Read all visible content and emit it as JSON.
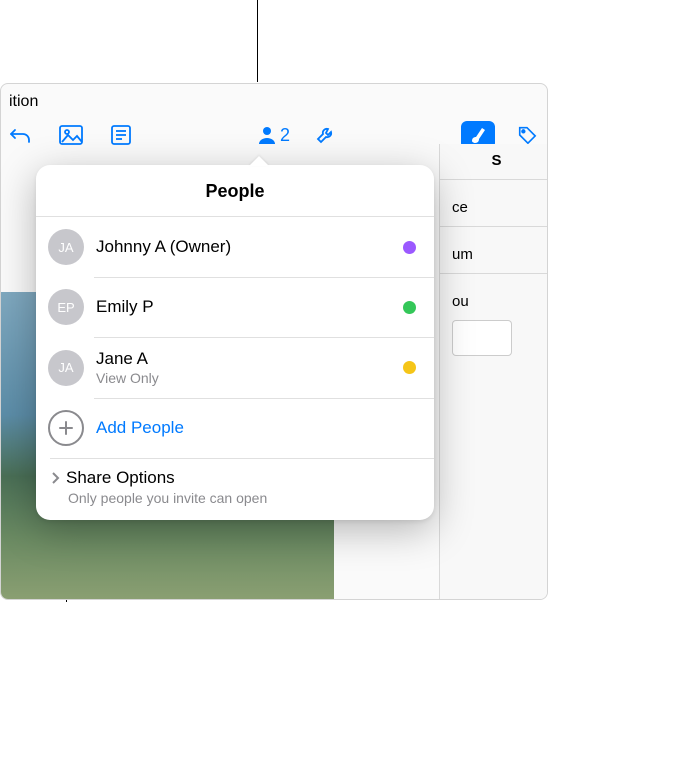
{
  "window": {
    "title_fragment": "ition"
  },
  "toolbar": {
    "collab_count": "2"
  },
  "right_panel": {
    "row1_fragment": "S",
    "row2_fragment": "ce",
    "row3_fragment": "um",
    "row4_fragment": "ou"
  },
  "popover": {
    "title": "People",
    "people": [
      {
        "initials": "JA",
        "name": "Johnny A (Owner)",
        "sub": "",
        "dot": "#9b59ff"
      },
      {
        "initials": "EP",
        "name": "Emily P",
        "sub": "",
        "dot": "#34c759"
      },
      {
        "initials": "JA",
        "name": "Jane A",
        "sub": "View Only",
        "dot": "#f5c518"
      }
    ],
    "add_label": "Add People",
    "share_title": "Share Options",
    "share_sub": "Only people you invite can open"
  },
  "colors": {
    "accent": "#007aff"
  }
}
